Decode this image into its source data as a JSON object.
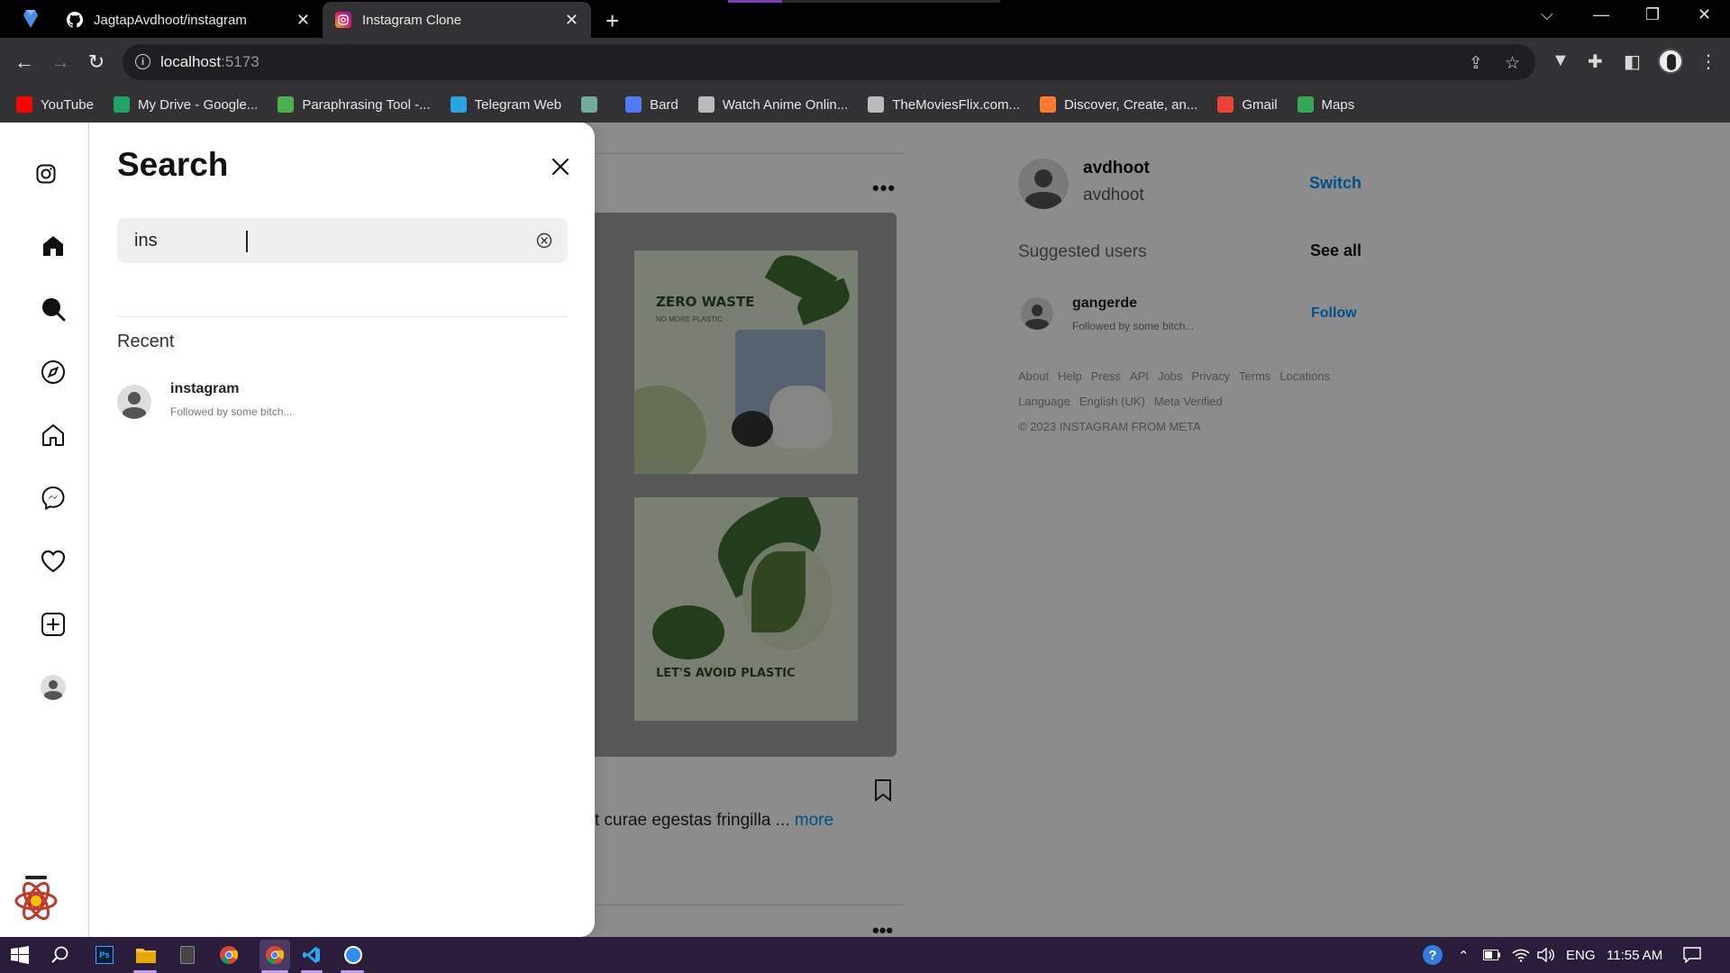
{
  "browser": {
    "tabs": [
      {
        "title": "JagtapAvdhoot/instagram",
        "icon": "github-icon"
      },
      {
        "title": "Instagram Clone",
        "icon": "instagram-icon",
        "active": true
      }
    ],
    "address": {
      "host": "localhost",
      "port": ":5173"
    },
    "bookmarks": [
      {
        "label": "YouTube",
        "icon": "youtube-icon",
        "color": "#ff0000"
      },
      {
        "label": "My Drive - Google...",
        "icon": "google-drive-icon",
        "color": "#1fa463"
      },
      {
        "label": "Paraphrasing Tool -...",
        "icon": "robot-icon",
        "color": "#4caf50"
      },
      {
        "label": "Telegram Web",
        "icon": "telegram-icon",
        "color": "#2aa3e0"
      },
      {
        "label": "",
        "icon": "chatgpt-icon",
        "color": "#74aa9c"
      },
      {
        "label": "Bard",
        "icon": "bard-icon",
        "color": "#4f7cf2"
      },
      {
        "label": "Watch Anime Onlin...",
        "icon": "anime-icon",
        "color": "#bbbbbb"
      },
      {
        "label": "TheMoviesFlix.com...",
        "icon": "globe-icon",
        "color": "#bbbbbb"
      },
      {
        "label": "Discover, Create, an...",
        "icon": "stack-icon",
        "color": "#ff7a2f"
      },
      {
        "label": "Gmail",
        "icon": "gmail-icon",
        "color": "#ea4335"
      },
      {
        "label": "Maps",
        "icon": "maps-icon",
        "color": "#34a853"
      }
    ]
  },
  "search_panel": {
    "title": "Search",
    "query": "ins",
    "recent_label": "Recent",
    "recent": [
      {
        "username": "instagram",
        "subtitle": "Followed by some bitch..."
      }
    ]
  },
  "feed": {
    "poster_top_title": "ZERO WASTE",
    "poster_top_sub": "NO MORE PLASTIC",
    "poster_bottom_title": "LET'S AVOID PLASTIC",
    "caption": "t curae egestas fringilla ...",
    "more_label": "more"
  },
  "sidebar_right": {
    "username": "avdhoot",
    "handle": "avdhoot",
    "switch_label": "Switch",
    "suggested_title": "Suggested users",
    "see_all_label": "See all",
    "suggested": [
      {
        "username": "gangerde",
        "subtitle": "Followed by some bitch...",
        "action": "Follow"
      }
    ],
    "links_row1": [
      "About",
      "Help",
      "Press",
      "API",
      "Jobs",
      "Privacy",
      "Terms",
      "Locations"
    ],
    "links_row2": [
      "Language",
      "English (UK)",
      "Meta Verified"
    ],
    "copyright": "© 2023 INSTAGRAM FROM META"
  },
  "taskbar": {
    "language": "ENG",
    "time": "11:55 AM"
  },
  "colors": {
    "accent": "#0095f6",
    "panel": "#ffffff",
    "taskbar": "#2a1d3b"
  }
}
